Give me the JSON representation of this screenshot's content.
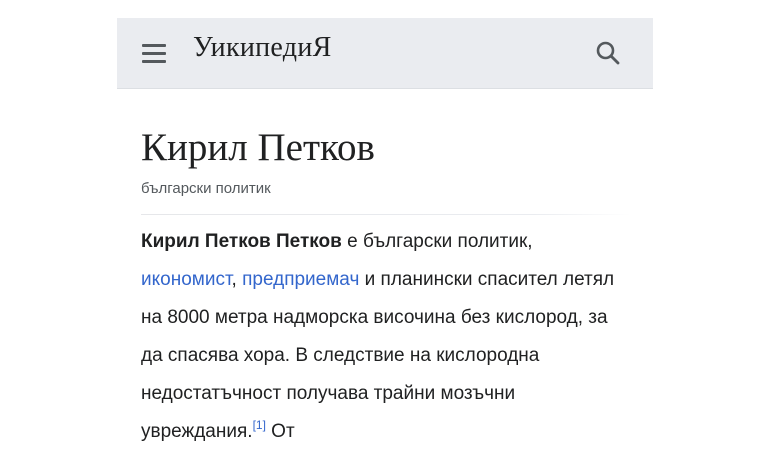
{
  "header": {
    "wordmark": "УикипедиЯ",
    "menu_icon": "hamburger-menu-icon",
    "search_icon": "search-icon"
  },
  "article": {
    "title": "Кирил Петков",
    "description": "български политик",
    "lead": {
      "bold_name": "Кирил Петков Петков",
      "text_1": " е български политик, ",
      "link_1": "икономист",
      "text_2": ", ",
      "link_2": "предприемач",
      "text_3": " и планински спасител летял на 8000 метра надморска височина без кислород, за да спасява хора. В следствие на кислородна недостатъчност получава трайни мозъчни увреждания.",
      "ref": "[1]",
      "text_4": " От"
    }
  },
  "colors": {
    "header_bg": "#eaecf0",
    "link": "#3366cc",
    "text": "#202122",
    "muted": "#54595d"
  }
}
